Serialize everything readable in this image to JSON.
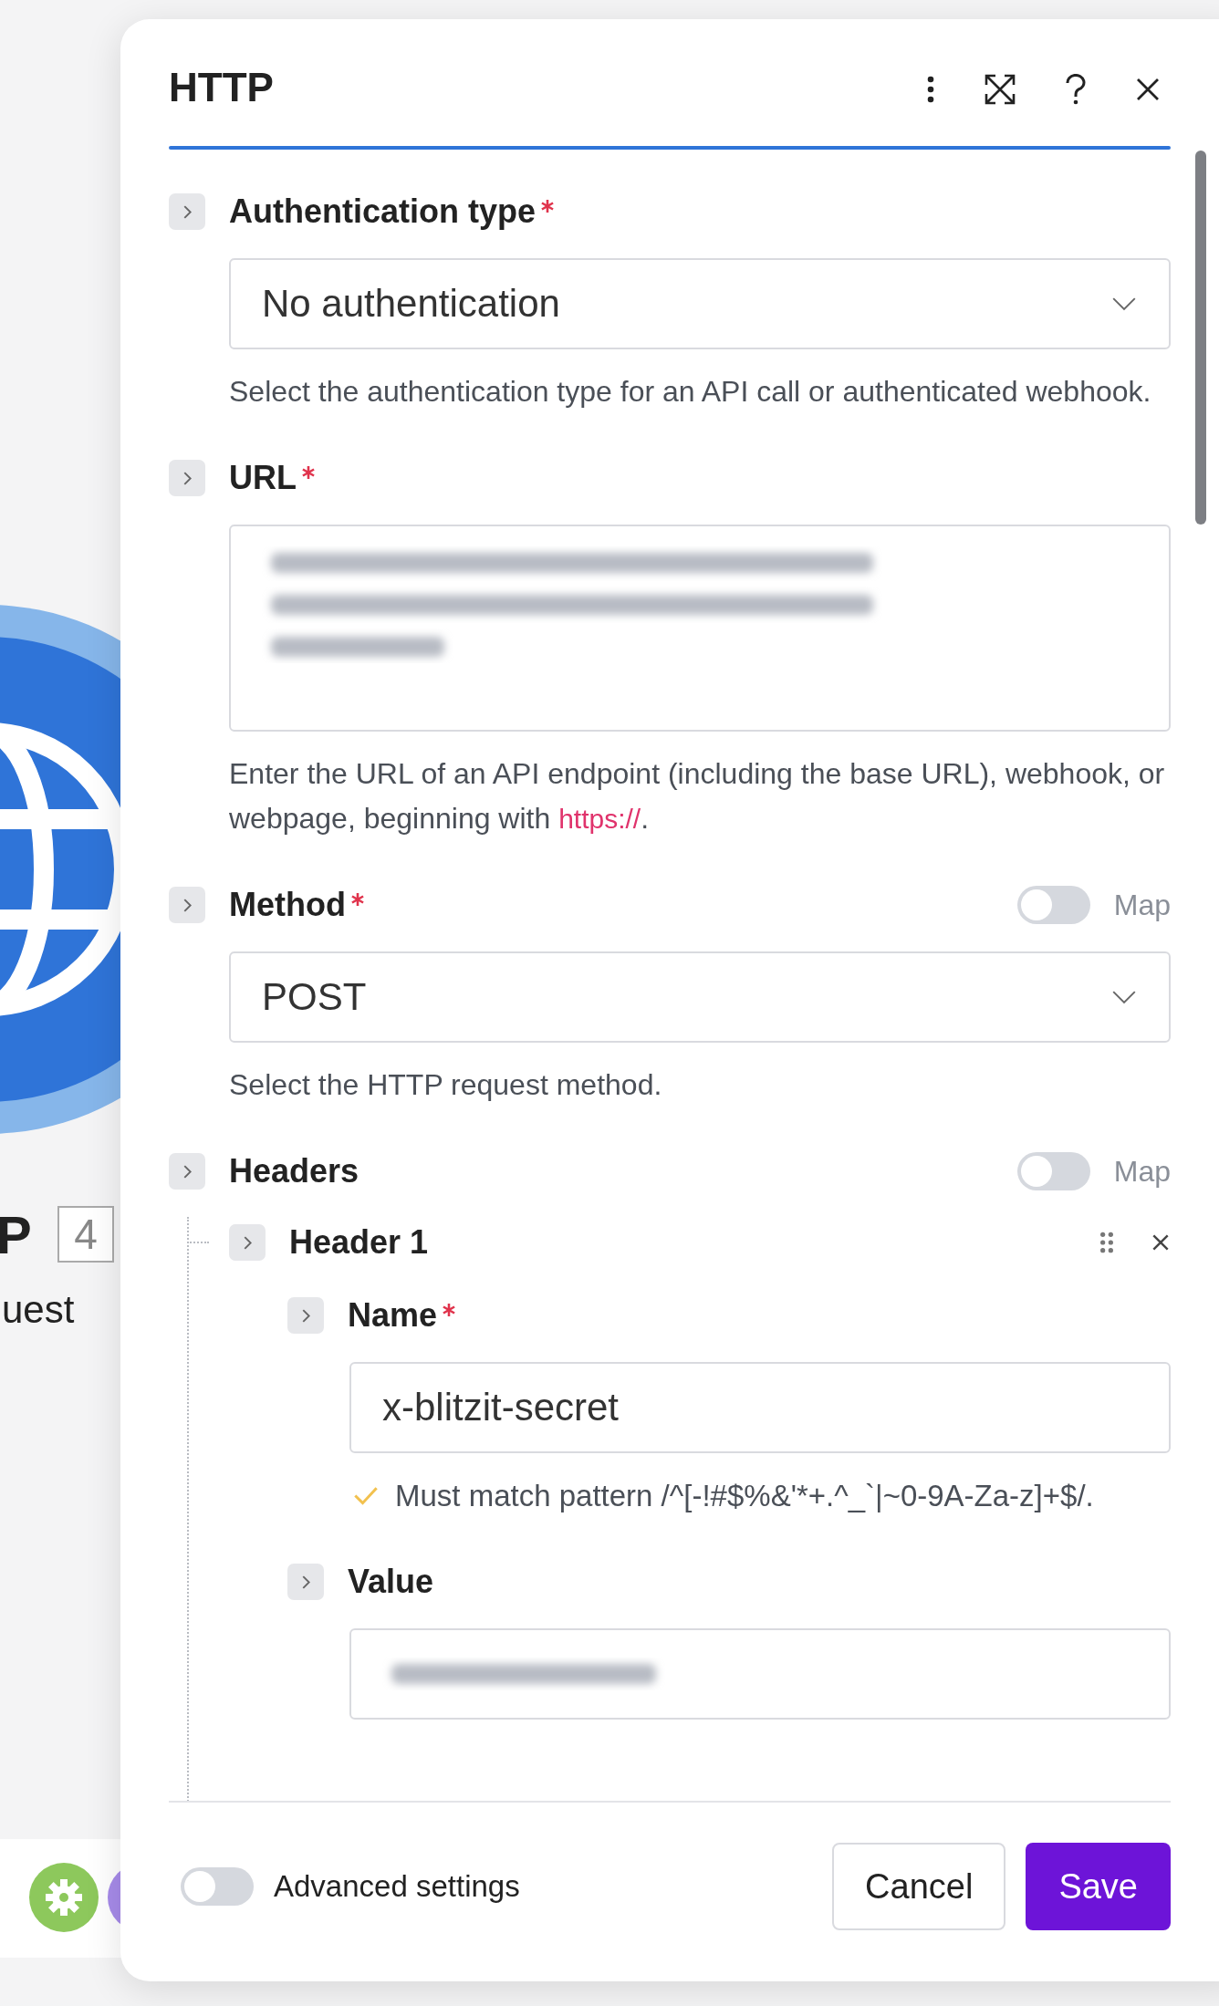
{
  "canvas": {
    "module_title": "P",
    "module_badge": "4",
    "module_subtitle": "uest"
  },
  "dialog": {
    "title": "HTTP"
  },
  "fields": [
    {
      "kind": "select",
      "label": "Authentication type",
      "required": true,
      "expanded": false,
      "value": "No authentication",
      "help": "Select the authentication type for an API call or authenticated webhook."
    },
    {
      "kind": "textarea",
      "label": "URL",
      "required": true,
      "expanded": false,
      "redacted": true,
      "help": "Enter the URL of an API endpoint (including the base URL), webhook, or webpage, beginning with",
      "help_link": "https://",
      "help_after": "."
    },
    {
      "kind": "select",
      "label": "Method",
      "required": true,
      "expanded": false,
      "map": {
        "label": "Map",
        "on": false
      },
      "value": "POST",
      "help": "Select the HTTP request method."
    },
    {
      "kind": "array",
      "label": "Headers",
      "required": false,
      "expanded": false,
      "map": {
        "label": "Map",
        "on": false
      },
      "items": [
        {
          "label": "Header 1",
          "expanded": false,
          "fields": [
            {
              "kind": "text",
              "label": "Name",
              "required": true,
              "expanded": false,
              "value": "x-blitzit-secret",
              "validation": "Must match pattern /^[-!#$%&'*+.^_`|~0-9A-Za-z]+$/.",
              "valid": true
            },
            {
              "kind": "text",
              "label": "Value",
              "required": false,
              "expanded": false,
              "redacted": true
            }
          ]
        }
      ]
    }
  ],
  "footer": {
    "advanced": {
      "label": "Advanced settings",
      "on": false
    },
    "buttons": [
      {
        "label": "Cancel",
        "kind": "secondary"
      },
      {
        "label": "Save",
        "kind": "primary"
      }
    ]
  }
}
